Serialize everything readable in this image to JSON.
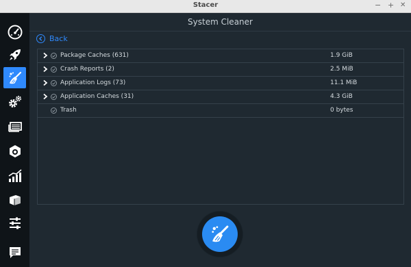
{
  "window": {
    "title": "Stacer",
    "controls": {
      "minimize": "−",
      "maximize": "+",
      "close": "✕"
    }
  },
  "sidebar": {
    "items": [
      {
        "icon": "speedometer-icon",
        "active": false
      },
      {
        "icon": "rocket-icon",
        "active": false
      },
      {
        "icon": "broom-icon",
        "active": true
      },
      {
        "icon": "gears-icon",
        "active": false
      },
      {
        "icon": "processes-icon",
        "active": false
      },
      {
        "icon": "uninstaller-icon",
        "active": false
      },
      {
        "icon": "resources-icon",
        "active": false
      },
      {
        "icon": "package-icon",
        "active": false
      },
      {
        "icon": "settings-sliders-icon",
        "active": false
      },
      {
        "icon": "feedback-icon",
        "active": false
      }
    ]
  },
  "header": {
    "title": "System Cleaner"
  },
  "back": {
    "label": "Back"
  },
  "tree": {
    "rows": [
      {
        "label": "Package Caches (631)",
        "size": "1.9 GiB",
        "expandable": true
      },
      {
        "label": "Crash Reports (2)",
        "size": "2.5 MiB",
        "expandable": true
      },
      {
        "label": "Application Logs (73)",
        "size": "11.1 MiB",
        "expandable": true
      },
      {
        "label": "Application Caches (31)",
        "size": "4.3 GiB",
        "expandable": true
      },
      {
        "label": "Trash",
        "size": "0 bytes",
        "expandable": false
      }
    ]
  },
  "clean_button": {
    "icon": "broom-icon"
  },
  "colors": {
    "accent": "#2f89fc",
    "sidebar_bg": "#0f1418",
    "main_bg": "#1f2931"
  }
}
